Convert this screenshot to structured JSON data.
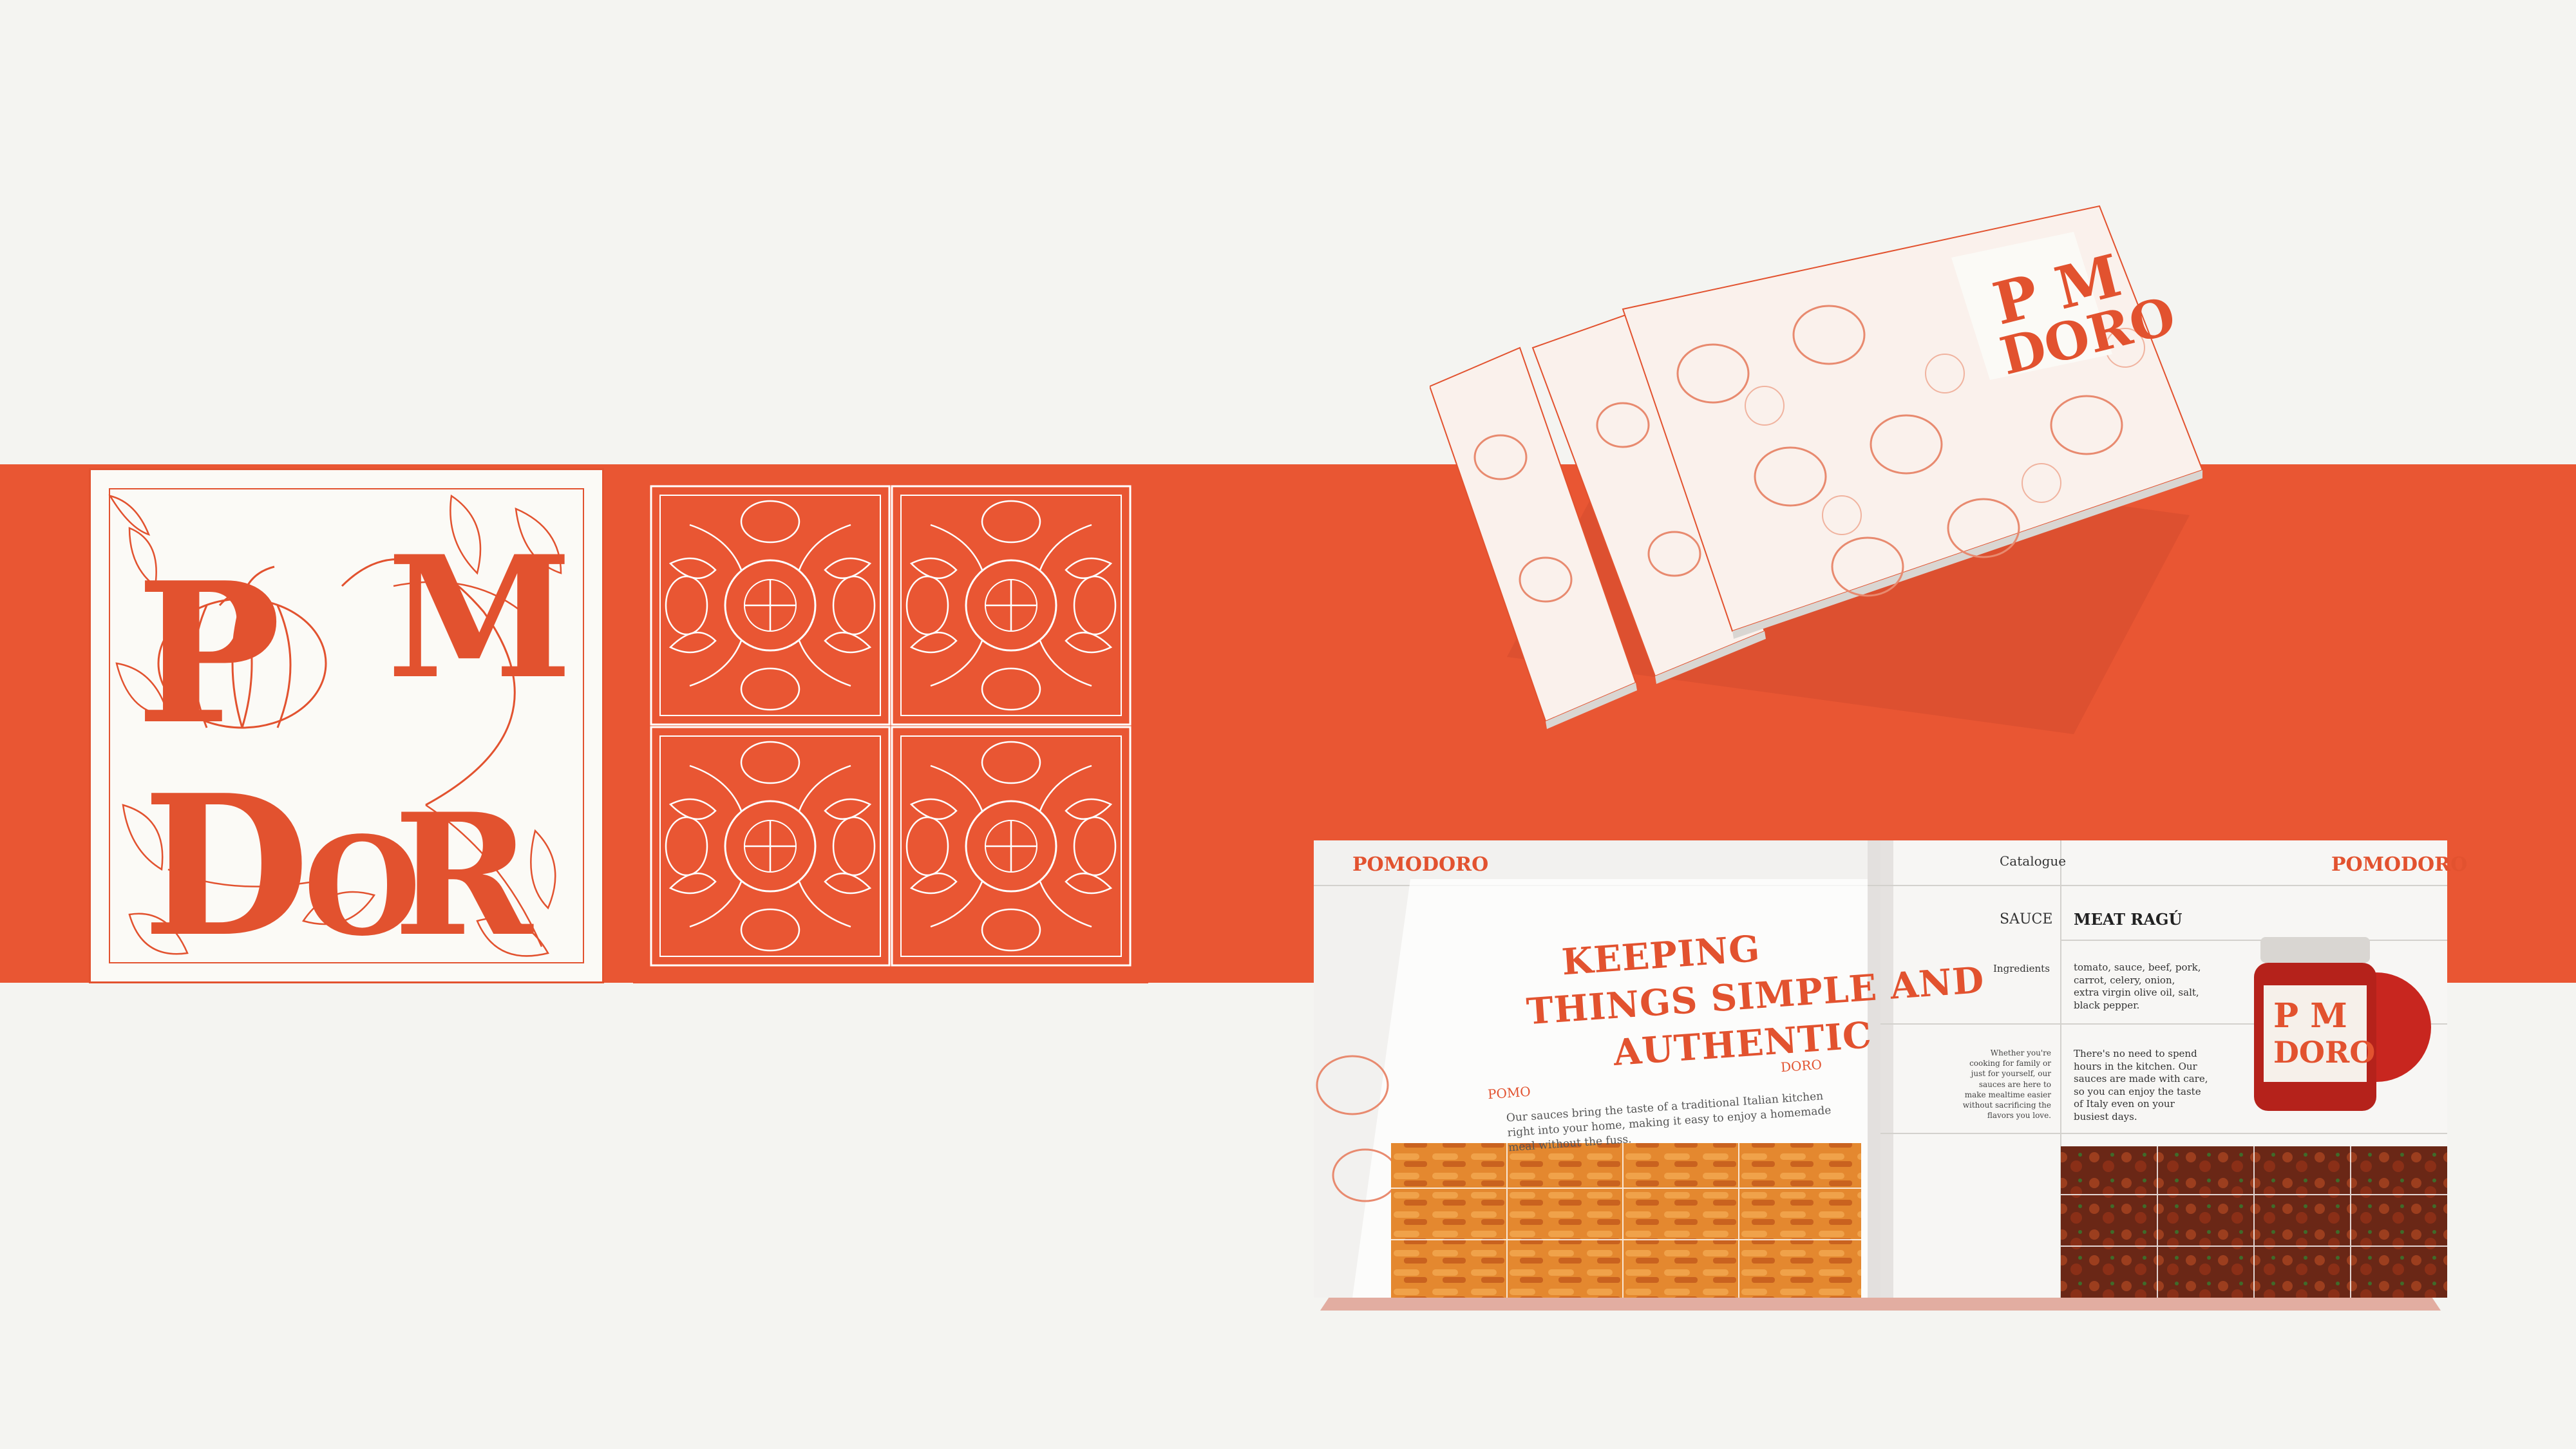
{
  "brand": {
    "logo_word": "POMODORO",
    "small_wordmark": "POMODORO",
    "left_tag": "POMO",
    "right_tag": "DORO"
  },
  "colors": {
    "background": "#f4f4f1",
    "accent": "#e95633",
    "line": "#e2522f",
    "paper": "#fbfaf6"
  },
  "spread": {
    "headline_line1": "KEEPING",
    "headline_line2": "THINGS SIMPLE AND",
    "headline_line3": "AUTHENTIC",
    "intro": "Our sauces bring the taste of a traditional Italian kitchen right into your home, making it easy to enjoy a homemade meal without the fuss.",
    "catalogue_label": "Catalogue",
    "category_label": "SAUCE",
    "product_name": "MEAT RAGÚ",
    "ingredients_label": "Ingredients",
    "ingredients_text": "tomato, sauce, beef, pork, carrot, celery, onion, extra virgin olive oil, salt, black pepper.",
    "left_note": "Whether you're cooking for family or just for yourself, our sauces are here to make mealtime easier without sacrificing the flavors you love.",
    "right_note": "There's no need to spend hours in the kitchen. Our sauces are made with care, so you can enjoy the taste of Italy even on your busiest days."
  },
  "icons": [
    "tomato-icon",
    "leaf-icon",
    "flower-icon"
  ]
}
